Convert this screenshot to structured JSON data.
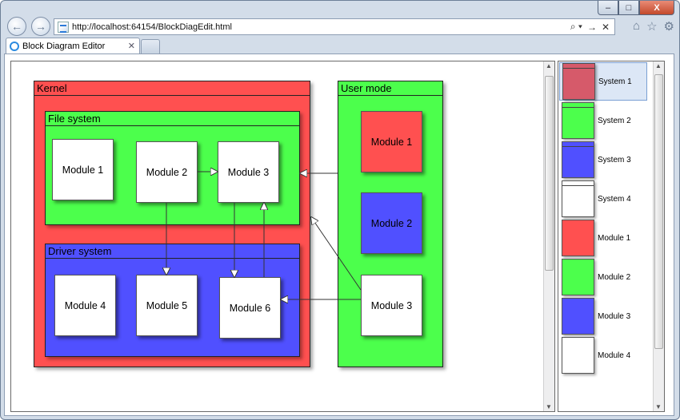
{
  "window": {
    "minimize": "–",
    "maximize": "□",
    "close": "X"
  },
  "nav": {
    "back_icon": "arrow-left-icon",
    "forward_icon": "arrow-right-icon",
    "url": "http://localhost:64154/BlockDiagEdit.html",
    "addr_tools": [
      "⌕ ▾",
      "→",
      "✕"
    ],
    "right_tools": [
      "⌂",
      "☆",
      "⚙"
    ]
  },
  "tab": {
    "title": "Block Diagram Editor",
    "close": "✕"
  },
  "colors": {
    "red": "#ff5050",
    "green": "#4cff4c",
    "blue": "#5050ff",
    "white": "#ffffff",
    "selected_red": "#d65a6a"
  },
  "diagram": {
    "kernel": {
      "title": "Kernel"
    },
    "file_system": {
      "title": "File system",
      "modules": [
        "Module 1",
        "Module 2",
        "Module 3"
      ]
    },
    "driver_system": {
      "title": "Driver system",
      "modules": [
        "Module 4",
        "Module 5",
        "Module 6"
      ]
    },
    "user_mode": {
      "title": "User mode",
      "modules": [
        "Module 1",
        "Module 2",
        "Module 3"
      ]
    }
  },
  "palette": {
    "items": [
      {
        "label": "System 1",
        "color": "#d65a6a",
        "type": "system",
        "selected": true
      },
      {
        "label": "System 2",
        "color": "#4cff4c",
        "type": "system"
      },
      {
        "label": "System 3",
        "color": "#5050ff",
        "type": "system"
      },
      {
        "label": "System 4",
        "color": "#ffffff",
        "type": "system"
      },
      {
        "label": "Module 1",
        "color": "#ff5050",
        "type": "module"
      },
      {
        "label": "Module 2",
        "color": "#4cff4c",
        "type": "module"
      },
      {
        "label": "Module 3",
        "color": "#5050ff",
        "type": "module"
      },
      {
        "label": "Module 4",
        "color": "#ffffff",
        "type": "module"
      }
    ]
  }
}
